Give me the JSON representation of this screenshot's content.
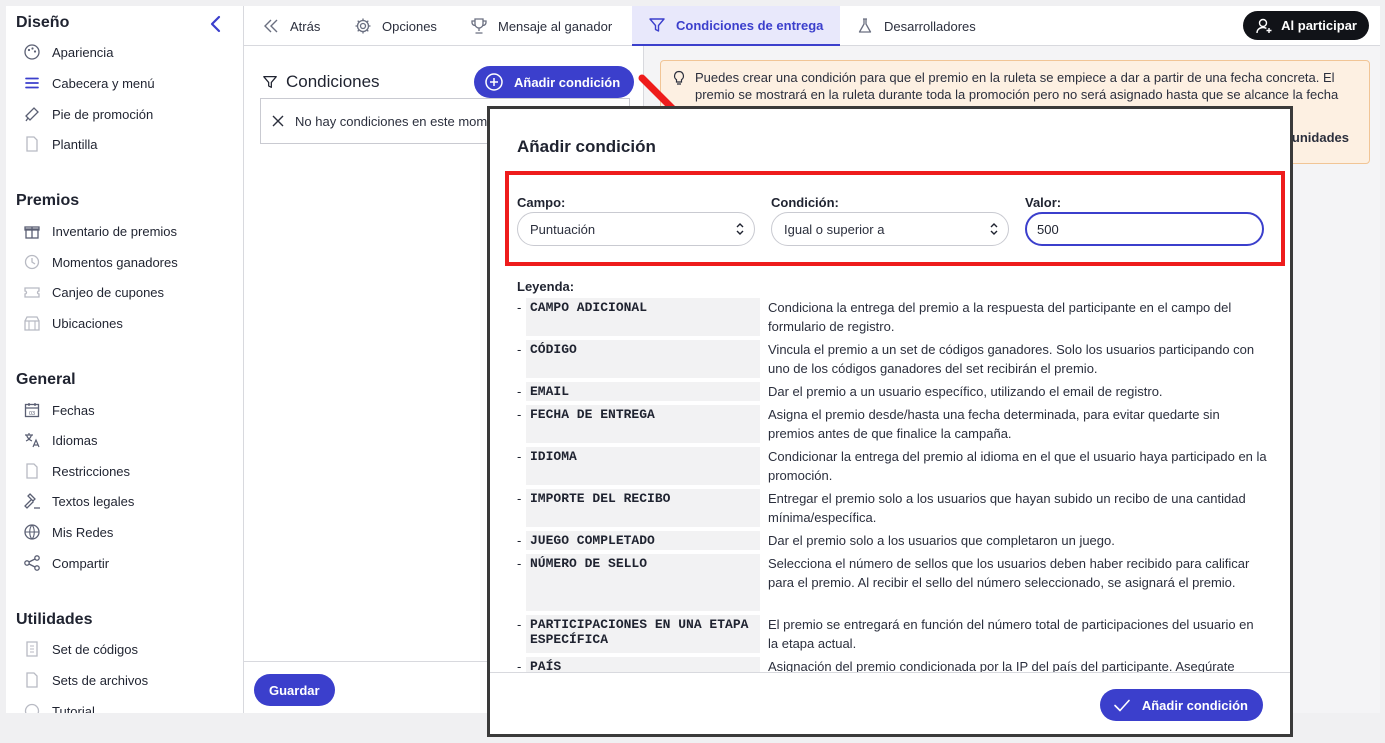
{
  "sidebar": {
    "sections": [
      {
        "title": "Diseño",
        "items": [
          {
            "label": "Apariencia",
            "icon": "palette-icon"
          },
          {
            "label": "Cabecera y menú",
            "icon": "menu-icon"
          },
          {
            "label": "Pie de promoción",
            "icon": "megaphone-icon"
          },
          {
            "label": "Plantilla",
            "icon": "document-icon"
          }
        ]
      },
      {
        "title": "Premios",
        "items": [
          {
            "label": "Inventario de premios",
            "icon": "gift-icon"
          },
          {
            "label": "Momentos ganadores",
            "icon": "clock-icon"
          },
          {
            "label": "Canjeo de cupones",
            "icon": "coupon-icon"
          },
          {
            "label": "Ubicaciones",
            "icon": "store-icon"
          }
        ]
      },
      {
        "title": "General",
        "items": [
          {
            "label": "Fechas",
            "icon": "calendar-icon"
          },
          {
            "label": "Idiomas",
            "icon": "translate-icon"
          },
          {
            "label": "Restricciones",
            "icon": "restriction-icon"
          },
          {
            "label": "Textos legales",
            "icon": "gavel-icon"
          },
          {
            "label": "Mis Redes",
            "icon": "globe-icon"
          },
          {
            "label": "Compartir",
            "icon": "share-icon"
          }
        ]
      },
      {
        "title": "Utilidades",
        "items": [
          {
            "label": "Set de códigos",
            "icon": "codes-icon"
          },
          {
            "label": "Sets de archivos",
            "icon": "file-icon"
          },
          {
            "label": "Tutorial",
            "icon": "tutorial-icon"
          }
        ]
      }
    ]
  },
  "topbar": {
    "tabs": [
      {
        "label": "Atrás",
        "icon": "double-chevron-left-icon"
      },
      {
        "label": "Opciones",
        "icon": "gear-icon"
      },
      {
        "label": "Mensaje al ganador",
        "icon": "trophy-icon"
      },
      {
        "label": "Condiciones de entrega",
        "icon": "filter-icon",
        "active": true
      },
      {
        "label": "Desarrolladores",
        "icon": "flask-icon"
      }
    ],
    "participate_label": "Al participar"
  },
  "conditions": {
    "title": "Condiciones",
    "add_button": "Añadir condición",
    "empty_text": "No hay condiciones en este momento",
    "save_button": "Guardar"
  },
  "info": {
    "text": "Puedes crear una condición para que el premio en la ruleta se empiece a dar a partir de una fecha concreta. El premio se mostrará en la ruleta durante toda la promoción pero no será asignado hasta que se alcance la fecha",
    "tail": "unidades"
  },
  "modal": {
    "title": "Añadir condición",
    "field_label": "Campo:",
    "field_value": "Puntuación",
    "condition_label": "Condición:",
    "condition_value": "Igual o superior a",
    "value_label": "Valor:",
    "value_value": "500",
    "legend_title": "Leyenda:",
    "legend": [
      {
        "key": "CAMPO ADICIONAL",
        "desc": "Condiciona la entrega del premio a la respuesta del participante en el campo del formulario de registro."
      },
      {
        "key": "CÓDIGO",
        "desc": "Vincula el premio a un set de códigos ganadores. Solo los usuarios participando con uno de los códigos ganadores del set recibirán el premio."
      },
      {
        "key": "EMAIL",
        "desc": "Dar el premio a un usuario específico, utilizando el email de registro."
      },
      {
        "key": "FECHA DE ENTREGA",
        "desc": "Asigna el premio desde/hasta una fecha determinada, para evitar quedarte sin premios antes de que finalice la campaña."
      },
      {
        "key": "IDIOMA",
        "desc": "Condicionar la entrega del premio al idioma en el que el usuario haya participado en la promoción."
      },
      {
        "key": "IMPORTE DEL RECIBO",
        "desc": "Entregar el premio solo a los usuarios que hayan subido un recibo de una cantidad mínima/específica."
      },
      {
        "key": "JUEGO COMPLETADO",
        "desc": "Dar el premio solo a los usuarios que completaron un juego."
      },
      {
        "key": "NÚMERO DE SELLO",
        "desc": "Selecciona el número de sellos que los usuarios deben haber recibido para calificar para el premio. Al recibir el sello del número seleccionado, se asignará el premio."
      },
      {
        "key": "PARTICIPACIONES EN UNA ETAPA ESPECÍFICA",
        "desc": "El premio se entregará en función del número total de participaciones del usuario en la etapa actual."
      },
      {
        "key": "PAÍS",
        "desc": "Asignación del premio condicionada por la IP del país del participante. Asegúrate"
      }
    ],
    "submit_button": "Añadir condición"
  },
  "colors": {
    "accent": "#3b3fcc",
    "highlight": "#ee1c1c",
    "info_bg": "#fdf0e2"
  }
}
